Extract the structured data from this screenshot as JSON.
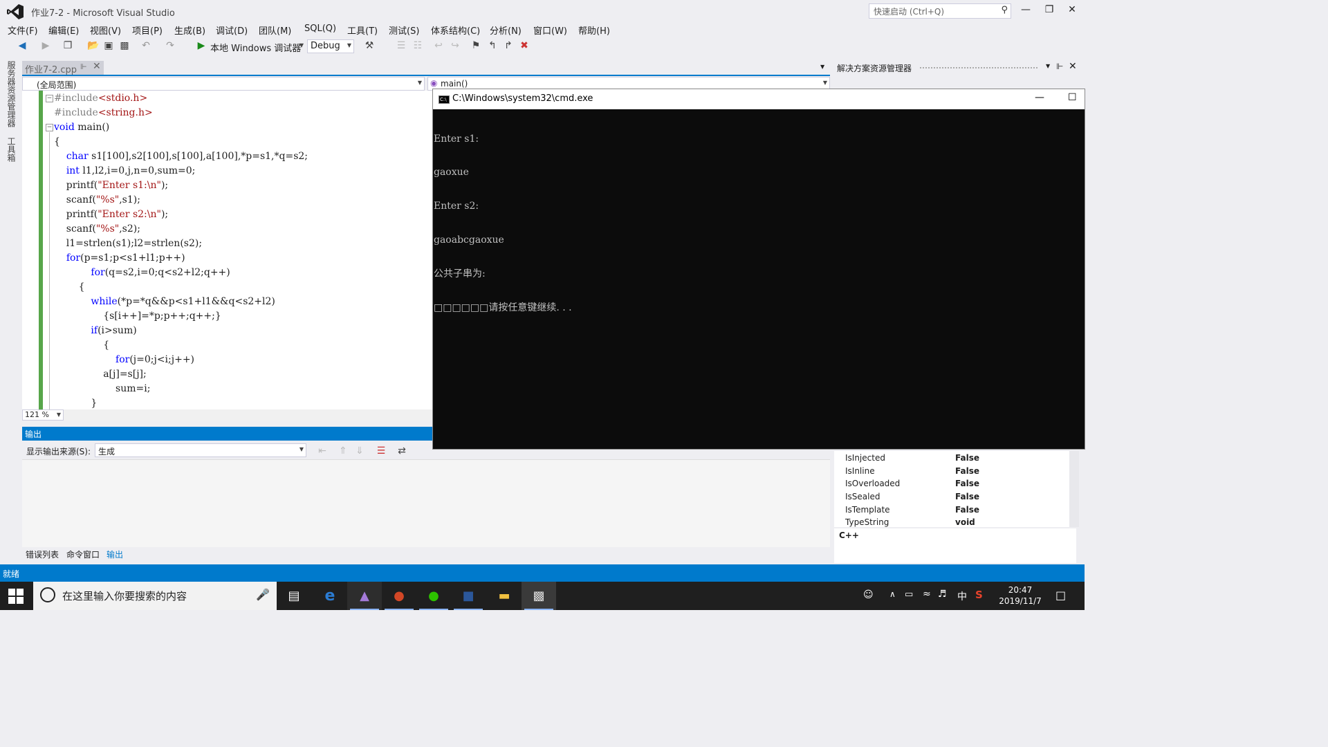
{
  "window": {
    "title": "作业7-2 - Microsoft Visual Studio",
    "quick_launch_placeholder": "快速启动 (Ctrl+Q)"
  },
  "menu": [
    "文件(F)",
    "编辑(E)",
    "视图(V)",
    "项目(P)",
    "生成(B)",
    "调试(D)",
    "团队(M)",
    "SQL(Q)",
    "工具(T)",
    "测试(S)",
    "体系结构(C)",
    "分析(N)",
    "窗口(W)",
    "帮助(H)"
  ],
  "toolbar": {
    "debugger_label": "本地 Windows 调试器",
    "config": "Debug"
  },
  "left_strip": {
    "server_explorer": "服务器资源管理器",
    "toolbox": "工具箱"
  },
  "editor": {
    "tab_title": "作业7-2.cpp",
    "scope": "(全局范围)",
    "member": "main()",
    "zoom": "121 %",
    "lines": [
      "#include<stdio.h>",
      "#include<string.h>",
      "void main()",
      "{",
      "    char s1[100],s2[100],s[100],a[100],*p=s1,*q=s2;",
      "    int l1,l2,i=0,j,n=0,sum=0;",
      "    printf(\"Enter s1:\\n\");",
      "    scanf(\"%s\",s1);",
      "    printf(\"Enter s2:\\n\");",
      "    scanf(\"%s\",s2);",
      "    l1=strlen(s1);l2=strlen(s2);",
      "    for(p=s1;p<s1+l1;p++)",
      "            for(q=s2,i=0;q<s2+l2;q++)",
      "        {",
      "            while(*p=*q&&p<s1+l1&&q<s2+l2)",
      "                {s[i++]=*p;p++;q++;}",
      "            if(i>sum)",
      "                {",
      "                    for(j=0;j<i;j++)",
      "                a[j]=s[j];",
      "                    sum=i;",
      "            }"
    ]
  },
  "output": {
    "header": "输出",
    "source_label": "显示输出来源(S):",
    "source_value": "生成",
    "tabs": [
      "错误列表",
      "命令窗口",
      "输出"
    ]
  },
  "solution_explorer": {
    "title": "解决方案资源管理器"
  },
  "properties": {
    "rows": [
      {
        "name": "IsInjected",
        "value": "False"
      },
      {
        "name": "IsInline",
        "value": "False"
      },
      {
        "name": "IsOverloaded",
        "value": "False"
      },
      {
        "name": "IsSealed",
        "value": "False"
      },
      {
        "name": "IsTemplate",
        "value": "False"
      },
      {
        "name": "TypeString",
        "value": "void"
      }
    ],
    "language": "C++"
  },
  "status": {
    "text": "就绪"
  },
  "cmd": {
    "title": "C:\\Windows\\system32\\cmd.exe",
    "lines": [
      "Enter s1:",
      "gaoxue",
      "Enter s2:",
      "gaoabcgaoxue",
      "公共子串为:",
      "□□□□□□请按任意键继续. . ."
    ]
  },
  "taskbar": {
    "search_placeholder": "在这里输入你要搜索的内容",
    "time": "20:47",
    "date": "2019/11/7",
    "ime": "中"
  },
  "colors": {
    "accent": "#007acc",
    "keyword": "#0000ff",
    "string": "#a31515",
    "preprocessor": "#808080"
  }
}
